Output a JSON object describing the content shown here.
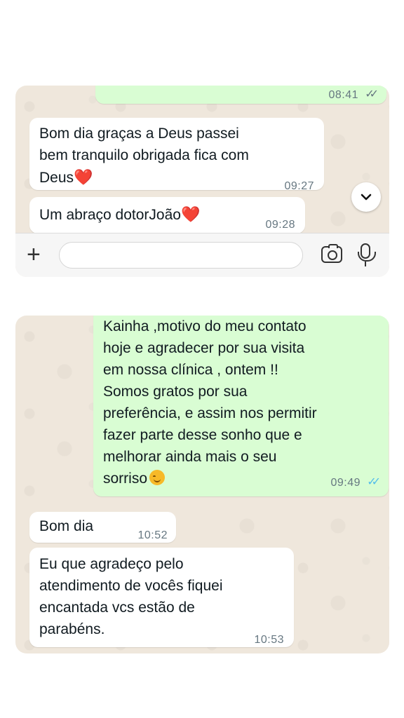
{
  "screenshot1": {
    "messages": [
      {
        "direction": "out",
        "text": "",
        "time": "08:41",
        "status": "read-grey"
      },
      {
        "direction": "in",
        "text": "Bom dia graças a Deus passei\nbem tranquilo obrigada fica com\nDeus",
        "emoji": "❤️",
        "time": "09:27"
      },
      {
        "direction": "in",
        "text": "Um abraço dotorJoão",
        "emoji": "❤️",
        "time": "09:28"
      }
    ],
    "scroll_button": {
      "icon": "chevron-down-icon"
    },
    "input_bar": {
      "attach_icon": "plus-icon",
      "message_value": "",
      "sticker_icon": "sticker-icon",
      "camera_icon": "camera-icon",
      "mic_icon": "microphone-icon"
    }
  },
  "screenshot2": {
    "messages": [
      {
        "direction": "out",
        "text": "Kainha ,motivo do meu contato\nhoje e agradecer por sua visita\nem nossa clínica , ontem !!\nSomos gratos por sua\npreferência, e assim nos permitir\nfazer parte desse sonho que e\nmelhorar ainda mais o seu\nsorriso",
        "emoji": "☺️",
        "time": "09:49",
        "status": "read-blue"
      },
      {
        "direction": "in",
        "text": "Bom dia",
        "time": "10:52"
      },
      {
        "direction": "in",
        "text": "Eu que agradeço pelo\natendimento de vocês fiquei\nencantada vcs estão de\nparabéns.",
        "time": "10:53"
      }
    ]
  },
  "colors": {
    "chat_background": "#efe7dc",
    "incoming_bubble": "#ffffff",
    "outgoing_bubble": "#d9fdd3",
    "read_ticks": "#53bdeb",
    "timestamp": "#667781",
    "heart": "#e0162b"
  }
}
